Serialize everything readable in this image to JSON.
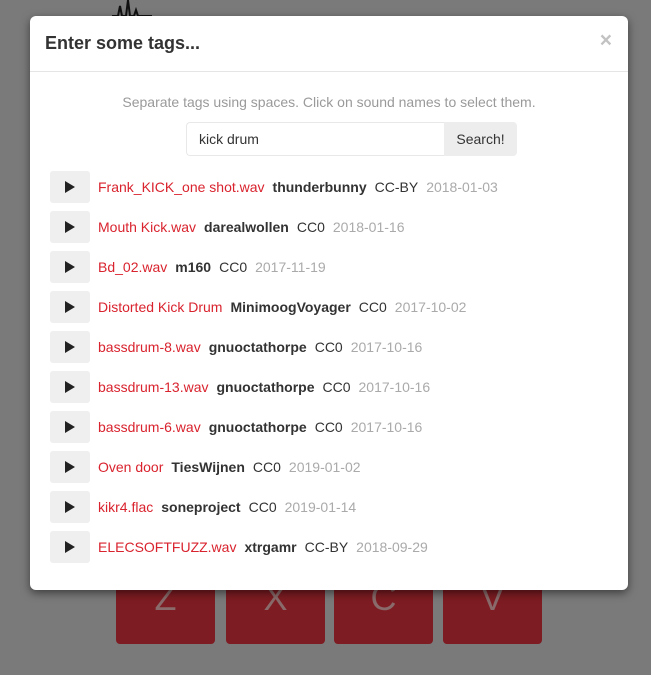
{
  "modal": {
    "title": "Enter some tags...",
    "close_label": "×",
    "hint": "Separate tags using spaces. Click on sound names to select them.",
    "search": {
      "value": "kick drum",
      "button_label": "Search!"
    }
  },
  "results": [
    {
      "name": "Frank_KICK_one shot.wav",
      "user": "thunderbunny",
      "license": "CC-BY",
      "date": "2018-01-03"
    },
    {
      "name": "Mouth Kick.wav",
      "user": "darealwollen",
      "license": "CC0",
      "date": "2018-01-16"
    },
    {
      "name": "Bd_02.wav",
      "user": "m160",
      "license": "CC0",
      "date": "2017-11-19"
    },
    {
      "name": "Distorted Kick Drum",
      "user": "MinimoogVoyager",
      "license": "CC0",
      "date": "2017-10-02"
    },
    {
      "name": "bassdrum-8.wav",
      "user": "gnuoctathorpe",
      "license": "CC0",
      "date": "2017-10-16"
    },
    {
      "name": "bassdrum-13.wav",
      "user": "gnuoctathorpe",
      "license": "CC0",
      "date": "2017-10-16"
    },
    {
      "name": "bassdrum-6.wav",
      "user": "gnuoctathorpe",
      "license": "CC0",
      "date": "2017-10-16"
    },
    {
      "name": "Oven door",
      "user": "TiesWijnen",
      "license": "CC0",
      "date": "2019-01-02"
    },
    {
      "name": "kikr4.flac",
      "user": "soneproject",
      "license": "CC0",
      "date": "2019-01-14"
    },
    {
      "name": "ELECSOFTFUZZ.wav",
      "user": "xtrgamr",
      "license": "CC-BY",
      "date": "2018-09-29"
    }
  ],
  "background": {
    "keys": [
      "Z",
      "X",
      "C",
      "V"
    ]
  },
  "colors": {
    "sound_name": "#d9232e",
    "key_background": "#7d1c22",
    "overlay": "#7a7a7a"
  },
  "icons": {
    "play": "play-icon",
    "close": "close-icon"
  }
}
